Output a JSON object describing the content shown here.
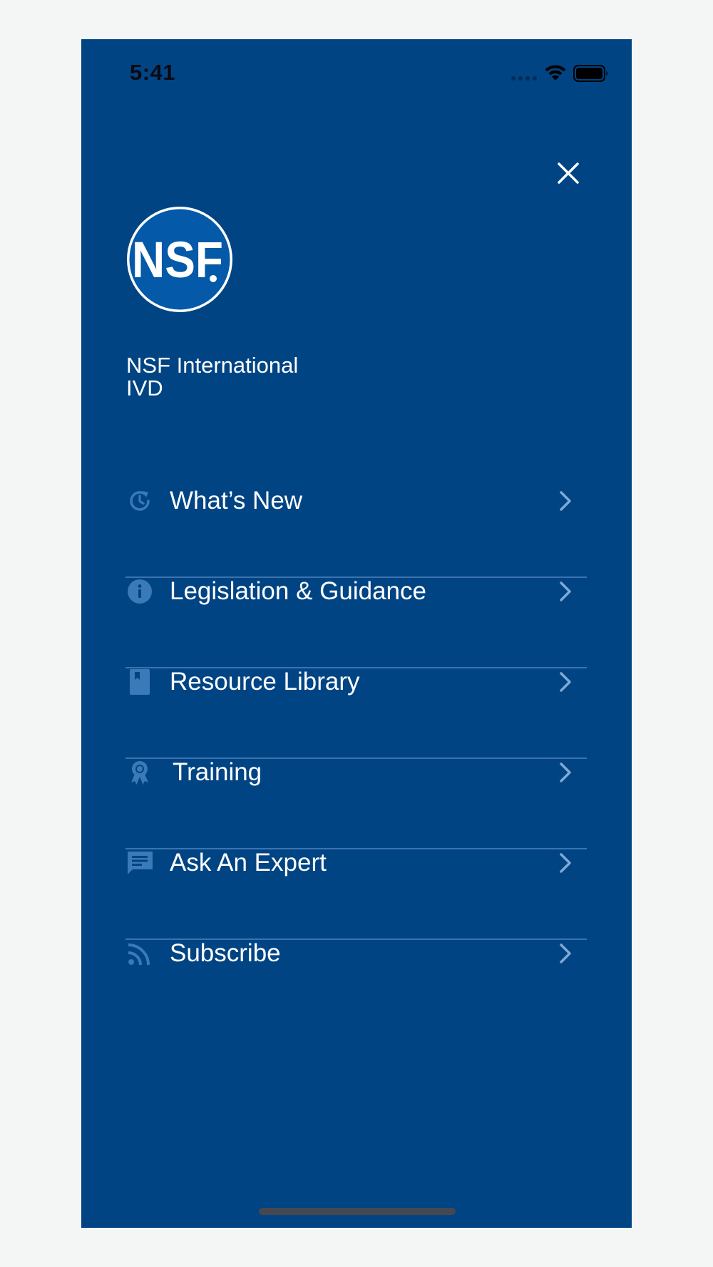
{
  "status_bar": {
    "time": "5:41"
  },
  "header": {
    "close_icon": "close-icon"
  },
  "logo": {
    "text": "NSF",
    "icon": "nsf-logo"
  },
  "org": {
    "name": "NSF International",
    "subtitle": "IVD"
  },
  "menu": {
    "items": [
      {
        "label": "What’s New",
        "icon": "history-icon"
      },
      {
        "label": "Legislation & Guidance",
        "icon": "info-icon"
      },
      {
        "label": "Resource Library",
        "icon": "book-icon"
      },
      {
        "label": "Training",
        "icon": "award-ribbon-icon"
      },
      {
        "label": "Ask An Expert",
        "icon": "chat-bubble-icon"
      },
      {
        "label": "Subscribe",
        "icon": "rss-icon"
      }
    ]
  },
  "colors": {
    "background": "#004483",
    "page": "#f4f5f5",
    "icon": "#3a7ab8",
    "divider": "#3a74b0",
    "text": "#ffffff"
  }
}
